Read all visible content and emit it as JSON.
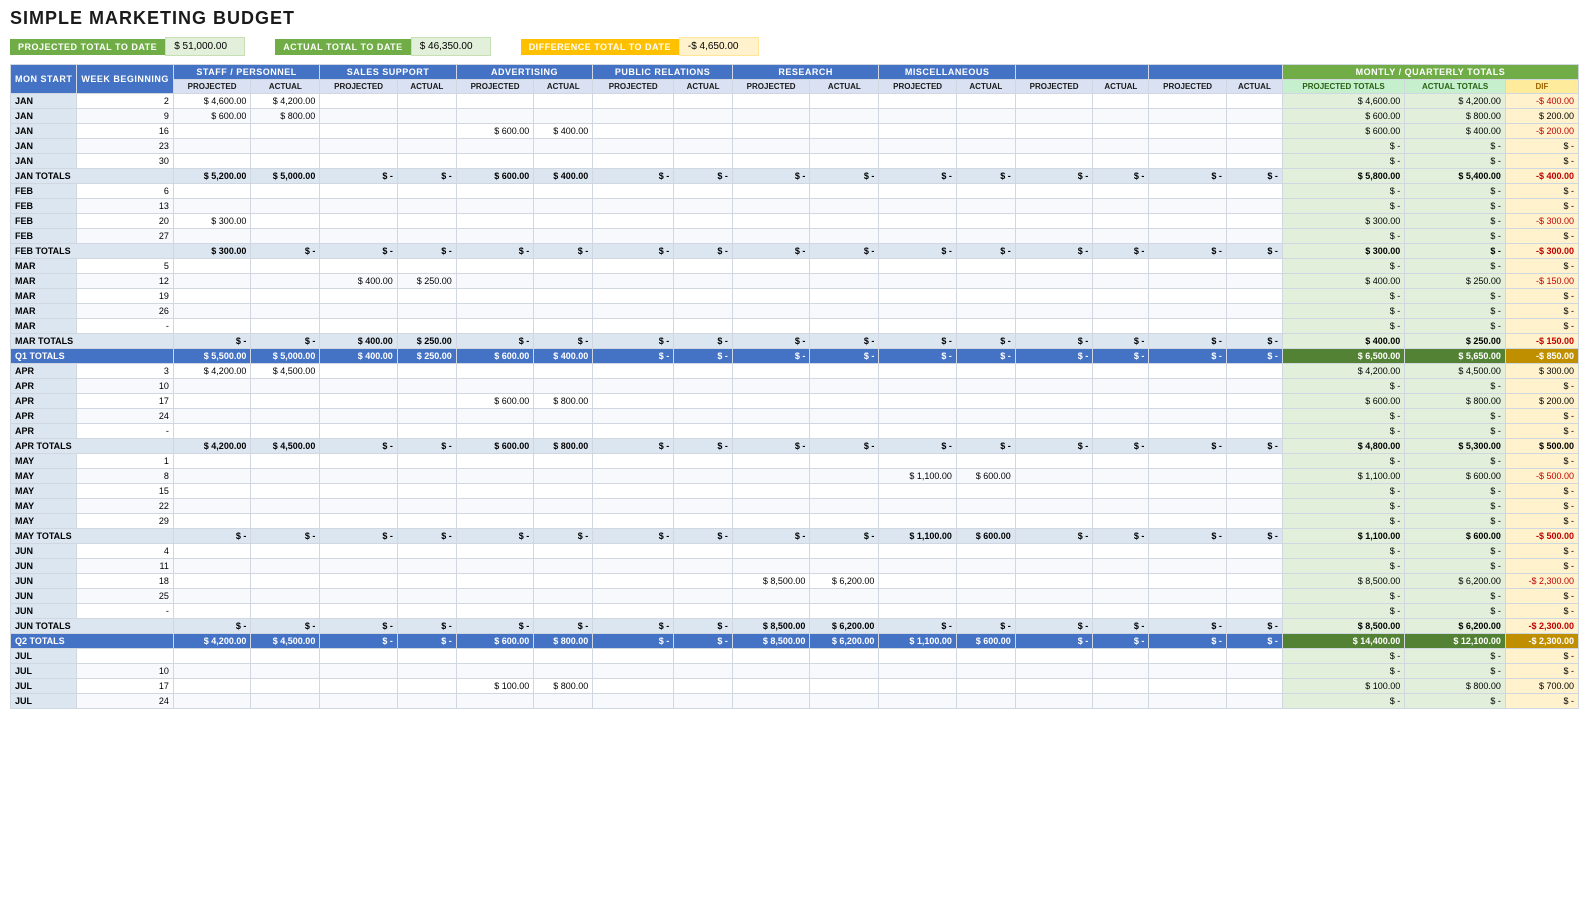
{
  "title": "SIMPLE MARKETING BUDGET",
  "summary": {
    "projected_label": "PROJECTED TOTAL TO DATE",
    "projected_value": "$ 51,000.00",
    "actual_label": "ACTUAL TOTAL TO DATE",
    "actual_value": "$ 46,350.00",
    "diff_label": "DIFFERENCE TOTAL TO DATE",
    "diff_value": "-$ 4,650.00"
  },
  "headers": {
    "mon_start": "MON START",
    "week_beginning": "WEEK BEGINNING",
    "staff": "STAFF / PERSONNEL",
    "sales": "SALES SUPPORT",
    "advertising": "ADVERTISING",
    "pr": "PUBLIC RELATIONS",
    "research": "RESEARCH",
    "misc": "MISCELLANEOUS",
    "extra1": "",
    "extra2": "",
    "extra3": "",
    "extra4": "",
    "monthly": "MONTLY / QUARTERLY TOTALS",
    "projected": "PROJECTED",
    "actual": "ACTUAL",
    "diff": "DIF",
    "proj_totals": "PROJECTED TOTALS",
    "act_totals": "ACTUAL TOTALS"
  }
}
